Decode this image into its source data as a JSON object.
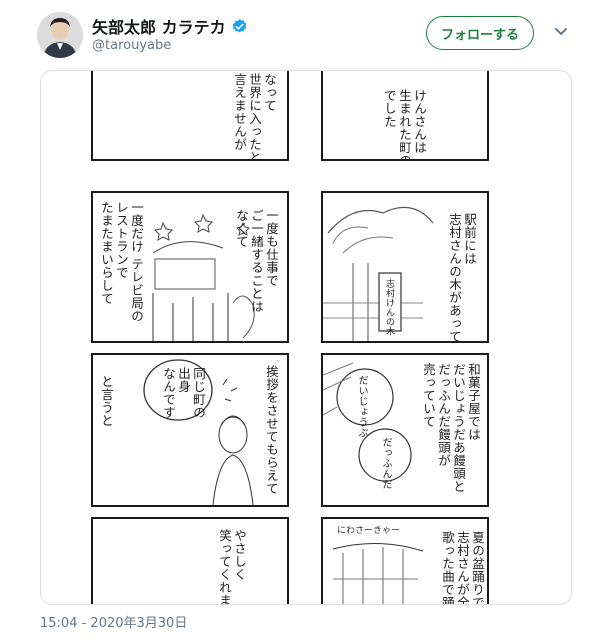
{
  "account": {
    "display_name": "矢部太郎 カラテカ",
    "handle": "@tarouyabe",
    "follow_label": "フォローする"
  },
  "icons": {
    "verified": "verified-badge-icon",
    "more": "chevron-down-icon",
    "brand_blue": "#1da1f2",
    "follow_green": "#1b7f3e"
  },
  "comic": {
    "r1_left": "なって\n世界に入ったとは\n言えませんが",
    "r1_right": "けんさんは\n生まれた町の\nでした",
    "r2_left": "一度だけ テレビ局の\nレストランで\nたまたまいらして",
    "r2_mid": "一度も仕事で\nご一緒することは\nなくて",
    "r2_right": "駅前には\n志村さんの木があって",
    "r2_sign": "志村けんの木",
    "r3_left": "と言うと",
    "r3_mid": "挨拶をさせてもらえて",
    "r3_bubble": "同じ町の\n出身\nなんです",
    "r3_right": "和菓子屋では\nだいじょうだあ饅頭と\nだっふんだ饅頭が\n売っていて",
    "r3_bubble_a": "だいじょうぶ",
    "r3_bubble_b": "だっふんだ",
    "r4_left": "やさしく\n笑ってくれま",
    "r4_right": "夏の盆踊りで\n志村さんが全\n歌った曲で踊",
    "r4_banner": "にわさーきゃー"
  },
  "timestamp": "15:04 - 2020年3月30日"
}
